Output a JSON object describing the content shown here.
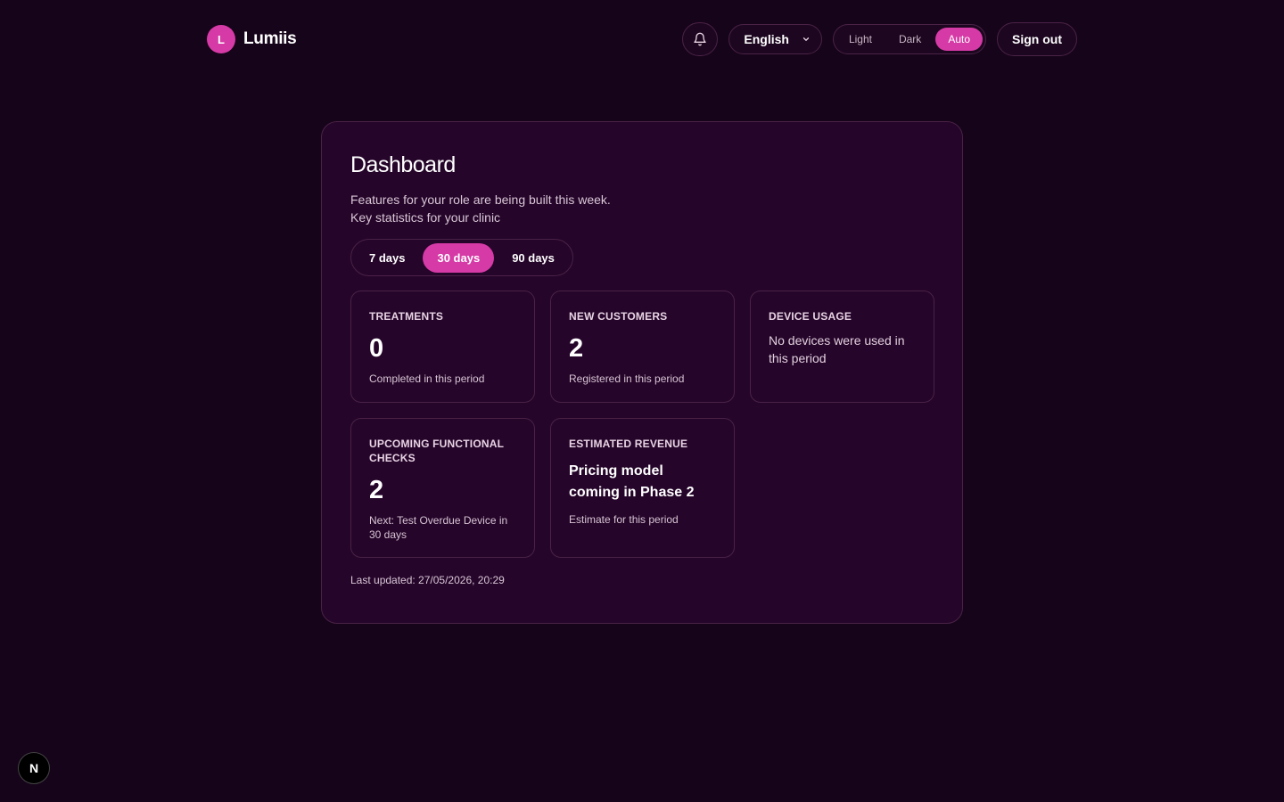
{
  "brand": {
    "initial": "L",
    "name": "Lumiis"
  },
  "header": {
    "language": "English",
    "theme_options": [
      "Light",
      "Dark",
      "Auto"
    ],
    "theme_selected": "Auto",
    "sign_out_label": "Sign out"
  },
  "dashboard": {
    "title": "Dashboard",
    "subtitle_line1": "Features for your role are being built this week.",
    "subtitle_line2": "Key statistics for your clinic",
    "ranges": [
      "7 days",
      "30 days",
      "90 days"
    ],
    "range_selected": "30 days",
    "stats": {
      "treatments": {
        "label": "TREATMENTS",
        "value": "0",
        "note": "Completed in this period"
      },
      "new_customers": {
        "label": "NEW CUSTOMERS",
        "value": "2",
        "note": "Registered in this period"
      },
      "device_usage": {
        "label": "DEVICE USAGE",
        "text": "No devices were used in this period"
      },
      "functional_checks": {
        "label": "UPCOMING FUNCTIONAL CHECKS",
        "value": "2",
        "note": "Next: Test Overdue Device in 30 days"
      },
      "estimated_revenue": {
        "label": "ESTIMATED REVENUE",
        "heading": "Pricing model coming in Phase 2",
        "note": "Estimate for this period"
      }
    },
    "last_updated": "Last updated: 27/05/2026, 20:29"
  },
  "dev_badge": {
    "letter": "N"
  },
  "colors": {
    "accent": "#d63aa6",
    "background": "#16041a",
    "card": "#25052a",
    "border": "#4a2246"
  },
  "icons": {
    "notifications": "bell-icon",
    "language_dropdown": "chevron-down-icon"
  }
}
